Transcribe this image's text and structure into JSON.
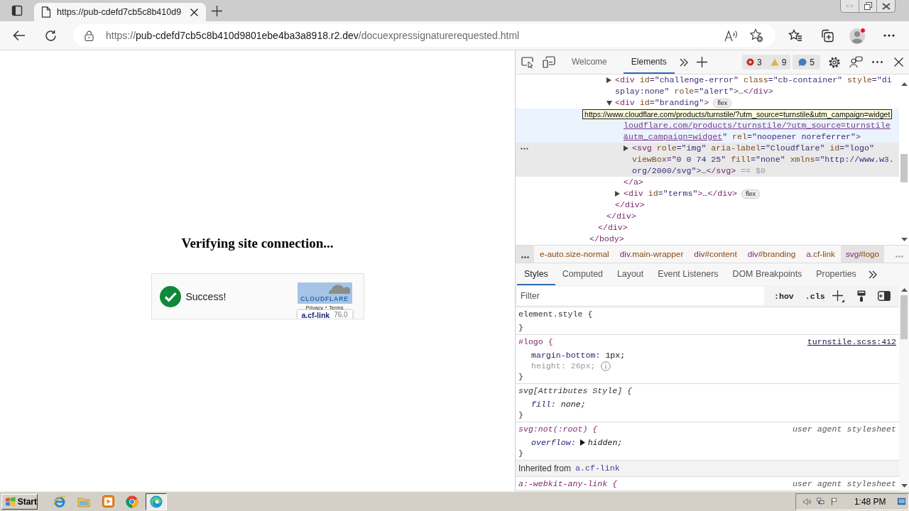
{
  "browser": {
    "tabs": [
      {
        "title": "https://pub-cdefd7cb5c8b410d9",
        "selected": true
      }
    ],
    "url": {
      "scheme": "https://",
      "host": "pub-cdefd7cb5c8b410d9801ebe4ba3a8918.r2.dev",
      "path": "/docuexpressignaturerequested.html"
    }
  },
  "page": {
    "heading": "Verifying site connection...",
    "widget": {
      "status": "Success!",
      "logo_text": "CLOUDFLARE",
      "logo_highlighted": true,
      "links": [
        "Privacy",
        "Terms"
      ],
      "inspect_overlay": {
        "selector": "a.cf-link",
        "size": "76.0"
      }
    }
  },
  "devtools": {
    "tabs": [
      {
        "label": "Welcome",
        "selected": false
      },
      {
        "label": "Elements",
        "selected": true
      }
    ],
    "issues": {
      "errors": "3",
      "warnings": "9",
      "info": "5"
    },
    "tree": [
      {
        "selected": false,
        "hovered": false,
        "close": [
          {
            "kind": "tag",
            "text": "</body>"
          }
        ],
        "children": [
          {
            "selected": false,
            "hovered": false,
            "close": [
              {
                "kind": "tag",
                "text": "</div>"
              }
            ],
            "children": [
              {
                "selected": false,
                "hovered": false,
                "close": [
                  {
                    "kind": "tag",
                    "text": "</div>"
                  }
                ],
                "children": [
                  {
                    "expanded": false,
                    "selected": false,
                    "hovered": false,
                    "lines": [
                      [
                        {
                          "kind": "tag",
                          "text": "<div"
                        },
                        {
                          "kind": "attr",
                          "text": " id"
                        },
                        {
                          "kind": "value",
                          "text": "=\"challenge-error\""
                        },
                        {
                          "kind": "attr",
                          "text": " class"
                        },
                        {
                          "kind": "value",
                          "text": "=\"cb-container\""
                        },
                        {
                          "kind": "attr",
                          "text": " style"
                        },
                        {
                          "kind": "value",
                          "text": "=\"di"
                        }
                      ],
                      [
                        {
                          "kind": "value",
                          "text": "splay:none\""
                        },
                        {
                          "kind": "attr",
                          "text": " role"
                        },
                        {
                          "kind": "value",
                          "text": "=\"alert\""
                        },
                        {
                          "kind": "tag",
                          "text": ">"
                        },
                        {
                          "kind": "text",
                          "text": "…"
                        },
                        {
                          "kind": "tag",
                          "text": "</div>"
                        }
                      ]
                    ]
                  },
                  {
                    "expanded": true,
                    "selected": false,
                    "hovered": false,
                    "badge": "flex",
                    "lines": [
                      [
                        {
                          "kind": "tag",
                          "text": "<div"
                        },
                        {
                          "kind": "attr",
                          "text": " id"
                        },
                        {
                          "kind": "value",
                          "text": "=\"branding\""
                        },
                        {
                          "kind": "tag",
                          "text": ">"
                        }
                      ]
                    ],
                    "close": [
                      {
                        "kind": "tag",
                        "text": "</div>"
                      }
                    ],
                    "children": [
                      {
                        "selected": false,
                        "hovered": true,
                        "tooltip": "https://www.cloudflare.com/products/turnstile/?utm_source=turnstile&utm_campaign=widget",
                        "lines": [
                          [
                            {
                              "kind": "link",
                              "text": "loudflare.com/products/turnstile/?utm_source=turnstile"
                            }
                          ],
                          [
                            {
                              "kind": "link",
                              "text": "&utm_campaign=widget"
                            },
                            {
                              "kind": "value",
                              "text": "\""
                            },
                            {
                              "kind": "attr",
                              "text": " rel"
                            },
                            {
                              "kind": "value",
                              "text": "=\"noopener noreferrer\""
                            },
                            {
                              "kind": "tag",
                              "text": ">"
                            }
                          ]
                        ],
                        "close": [
                          {
                            "kind": "tag",
                            "text": "</a>"
                          }
                        ],
                        "children": [
                          {
                            "expanded": false,
                            "selected": true,
                            "hovered": false,
                            "lines": [
                              [
                                {
                                  "kind": "tag",
                                  "text": "<svg"
                                },
                                {
                                  "kind": "attr",
                                  "text": " role"
                                },
                                {
                                  "kind": "value",
                                  "text": "=\"img\""
                                },
                                {
                                  "kind": "attr",
                                  "text": " aria-label"
                                },
                                {
                                  "kind": "value",
                                  "text": "=\"Cloudflare\""
                                },
                                {
                                  "kind": "attr",
                                  "text": " id"
                                },
                                {
                                  "kind": "value",
                                  "text": "=\"logo\""
                                }
                              ],
                              [
                                {
                                  "kind": "attr",
                                  "text": "viewBox"
                                },
                                {
                                  "kind": "value",
                                  "text": "=\"0 0 74 25\""
                                },
                                {
                                  "kind": "attr",
                                  "text": " fill"
                                },
                                {
                                  "kind": "value",
                                  "text": "=\"none\""
                                },
                                {
                                  "kind": "attr",
                                  "text": " xmlns"
                                },
                                {
                                  "kind": "value",
                                  "text": "=\"http://www.w3."
                                }
                              ],
                              [
                                {
                                  "kind": "value",
                                  "text": "org/2000/svg\""
                                },
                                {
                                  "kind": "tag",
                                  "text": ">"
                                },
                                {
                                  "kind": "text",
                                  "text": "…"
                                },
                                {
                                  "kind": "tag",
                                  "text": "</svg>"
                                },
                                {
                                  "kind": "dim",
                                  "text": " == $0"
                                }
                              ]
                            ]
                          }
                        ]
                      },
                      {
                        "expanded": false,
                        "selected": false,
                        "hovered": false,
                        "badge": "flex",
                        "lines": [
                          [
                            {
                              "kind": "tag",
                              "text": "<div"
                            },
                            {
                              "kind": "attr",
                              "text": " id"
                            },
                            {
                              "kind": "value",
                              "text": "=\"terms\""
                            },
                            {
                              "kind": "tag",
                              "text": ">"
                            },
                            {
                              "kind": "text",
                              "text": "…"
                            },
                            {
                              "kind": "tag",
                              "text": "</div>"
                            }
                          ]
                        ]
                      }
                    ]
                  }
                ]
              }
            ]
          }
        ]
      }
    ],
    "breadcrumbs": [
      {
        "suffix": "e-auto.size-normal",
        "selected": false
      },
      {
        "tag": "div",
        "suffix": ".main-wrapper",
        "selected": false
      },
      {
        "tag": "div",
        "suffix": "#content",
        "selected": false
      },
      {
        "tag": "div",
        "suffix": "#branding",
        "selected": false
      },
      {
        "tag": "a",
        "suffix": ".cf-link",
        "selected": false
      },
      {
        "tag": "svg",
        "suffix": "#logo",
        "selected": true
      }
    ],
    "subtabs": [
      {
        "label": "Styles",
        "selected": true
      },
      {
        "label": "Computed",
        "selected": false
      },
      {
        "label": "Layout",
        "selected": false
      },
      {
        "label": "Event Listeners",
        "selected": false
      },
      {
        "label": "DOM Breakpoints",
        "selected": false
      },
      {
        "label": "Properties",
        "selected": false
      }
    ],
    "filter": {
      "placeholder": "Filter"
    },
    "toggles": [
      ":hov",
      ".cls"
    ],
    "rules": [
      {
        "kind": "inline",
        "selector": "element.style {",
        "close": "}"
      },
      {
        "kind": "matched",
        "selector": "#logo {",
        "source": "turnstile.scss:412",
        "declarations": [
          {
            "property": "margin-bottom:",
            "value": "1px;",
            "inactive": false,
            "expandable": false
          },
          {
            "property": "height:",
            "value": "26px;",
            "inactive": true,
            "expandable": false
          }
        ],
        "close": "}"
      },
      {
        "kind": "attributes",
        "selector": "svg[Attributes Style] {",
        "declarations": [
          {
            "property": "fill:",
            "value": "none;",
            "inactive": false,
            "expandable": false
          }
        ],
        "close": "}"
      },
      {
        "kind": "user-agent",
        "selector": "svg:not(:root) {",
        "origin": "user agent stylesheet",
        "declarations": [
          {
            "property": "overflow:",
            "value": "hidden;",
            "inactive": false,
            "expandable": true
          }
        ],
        "close": "}"
      },
      {
        "kind": "inherited",
        "label": "Inherited from",
        "link": "a.cf-link"
      },
      {
        "kind": "user-agent",
        "selector": "a:-webkit-any-link {",
        "origin": "user agent stylesheet"
      }
    ]
  },
  "taskbar": {
    "start": "Start",
    "apps": [
      {
        "kind": "ie",
        "selected": false
      },
      {
        "kind": "folder",
        "selected": false
      },
      {
        "kind": "player",
        "selected": false
      },
      {
        "kind": "chrome",
        "selected": false
      },
      {
        "kind": "edge",
        "selected": true
      }
    ],
    "clock": "1:48 PM"
  }
}
